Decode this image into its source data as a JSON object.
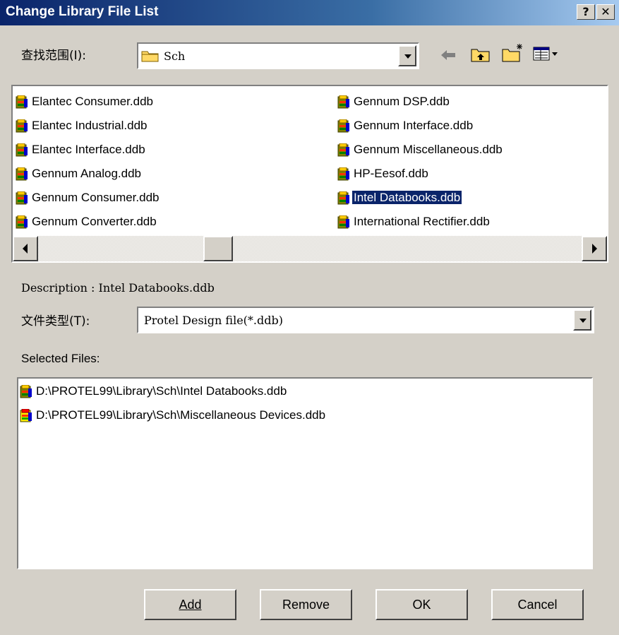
{
  "window": {
    "title": "Change Library File List",
    "help_label": "?",
    "close_label": "✕"
  },
  "lookin": {
    "label": "查找范围(I):",
    "value": "Sch"
  },
  "file_list": [
    {
      "name": "Elantec Consumer.ddb",
      "selected": false
    },
    {
      "name": "Elantec Industrial.ddb",
      "selected": false
    },
    {
      "name": "Elantec Interface.ddb",
      "selected": false
    },
    {
      "name": "Gennum Analog.ddb",
      "selected": false
    },
    {
      "name": "Gennum Consumer.ddb",
      "selected": false
    },
    {
      "name": "Gennum Converter.ddb",
      "selected": false
    },
    {
      "name": "Gennum DSP.ddb",
      "selected": false
    },
    {
      "name": "Gennum Interface.ddb",
      "selected": false
    },
    {
      "name": "Gennum Miscellaneous.ddb",
      "selected": false
    },
    {
      "name": "HP-Eesof.ddb",
      "selected": false
    },
    {
      "name": "Intel Databooks.ddb",
      "selected": true
    },
    {
      "name": "International Rectifier.ddb",
      "selected": false
    }
  ],
  "description": {
    "text": "Description : Intel Databooks.ddb"
  },
  "filetype": {
    "label": "文件类型(T):",
    "value": "Protel Design file(*.ddb)"
  },
  "selected_files": {
    "label": "Selected Files:",
    "items": [
      "D:\\PROTEL99\\Library\\Sch\\Intel Databooks.ddb",
      "D:\\PROTEL99\\Library\\Sch\\Miscellaneous Devices.ddb"
    ]
  },
  "buttons": {
    "add": "Add",
    "remove": "Remove",
    "ok": "OK",
    "cancel": "Cancel"
  },
  "icons": {
    "folder": "folder-icon",
    "back": "back-arrow-icon",
    "up": "up-folder-icon",
    "newfolder": "new-folder-icon",
    "view": "view-menu-icon",
    "ddb": "ddb-file-icon"
  },
  "colors": {
    "title_bar_start": "#0a246a",
    "title_bar_end": "#a6caf0",
    "selection": "#0a246a",
    "dialog_bg": "#d4d0c8"
  }
}
